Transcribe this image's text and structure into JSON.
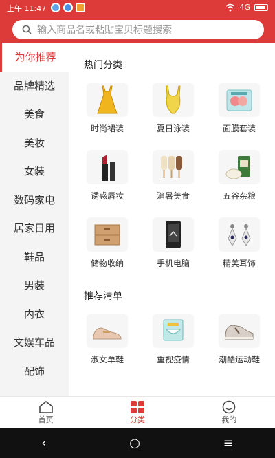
{
  "status": {
    "time": "上午 11:47",
    "network": "4G"
  },
  "search": {
    "placeholder": "输入商品名或粘贴宝贝标题搜索"
  },
  "sidebar": {
    "items": [
      {
        "label": "为你推荐",
        "active": true
      },
      {
        "label": "品牌精选"
      },
      {
        "label": "美食"
      },
      {
        "label": "美妆"
      },
      {
        "label": "女装"
      },
      {
        "label": "数码家电"
      },
      {
        "label": "居家日用"
      },
      {
        "label": "鞋品"
      },
      {
        "label": "男装"
      },
      {
        "label": "内衣"
      },
      {
        "label": "文娱车品"
      },
      {
        "label": "配饰"
      }
    ]
  },
  "sections": [
    {
      "title": "热门分类",
      "items": [
        {
          "label": "时尚裙装",
          "icon": "dress-icon"
        },
        {
          "label": "夏日泳装",
          "icon": "swimsuit-icon"
        },
        {
          "label": "面膜套装",
          "icon": "face-mask-icon"
        },
        {
          "label": "诱惑唇妆",
          "icon": "lipstick-icon"
        },
        {
          "label": "消暑美食",
          "icon": "popsicle-icon"
        },
        {
          "label": "五谷杂粮",
          "icon": "grain-icon"
        },
        {
          "label": "储物收纳",
          "icon": "storage-box-icon"
        },
        {
          "label": "手机电脑",
          "icon": "phone-icon"
        },
        {
          "label": "精美耳饰",
          "icon": "earring-icon"
        }
      ]
    },
    {
      "title": "推荐清单",
      "items": [
        {
          "label": "淑女单鞋",
          "icon": "shoe-icon"
        },
        {
          "label": "重视疫情",
          "icon": "mask-box-icon"
        },
        {
          "label": "潮酷运动鞋",
          "icon": "sneaker-icon"
        }
      ]
    }
  ],
  "tabs": [
    {
      "label": "首页",
      "icon": "home-icon",
      "active": false
    },
    {
      "label": "分类",
      "icon": "category-icon",
      "active": true
    },
    {
      "label": "我的",
      "icon": "profile-icon",
      "active": false
    }
  ],
  "navbar": {
    "back": "‹",
    "home": "○",
    "menu": "≡"
  },
  "colors": {
    "brand": "#dd3b3a"
  }
}
